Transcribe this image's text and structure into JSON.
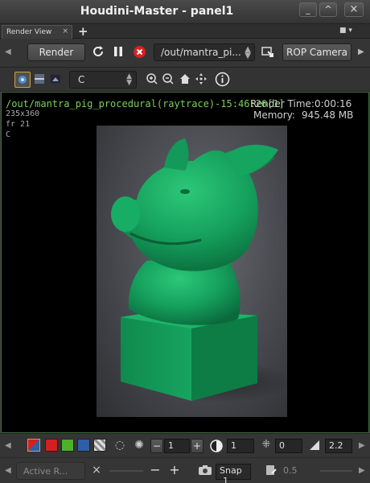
{
  "window": {
    "title": "Houdini-Master - panel1",
    "controls": [
      "_",
      "^",
      "×"
    ]
  },
  "tabs": {
    "active_label": "Render View",
    "close_glyph": "×",
    "add_glyph": "+",
    "menu_glyph": "■ ▾"
  },
  "toolbar1": {
    "render_label": "Render",
    "rop_path": "/out/mantra_pi...",
    "camera_label": "ROP Camera",
    "icons": [
      "refresh-icon",
      "pause-icon",
      "stop-icon",
      "render-region-icon"
    ]
  },
  "toolbar2": {
    "channel_value": "C",
    "icons": [
      "snapshot-icon",
      "compare-icon",
      "display-icon",
      "zoom-in-icon",
      "zoom-out-icon",
      "home-icon",
      "pan-icon",
      "info-icon"
    ]
  },
  "viewport": {
    "render_name": "/out/mantra_pig_procedural(raytrace)-15:46:26[1]",
    "resolution": "235x360",
    "frame": "fr 21",
    "channel": "C",
    "render_time_label": "Render Time:",
    "render_time_value": "0:00:16",
    "memory_label": "Memory:",
    "memory_value": "945.48 MB"
  },
  "toolbar3": {
    "swatches": [
      {
        "name": "rgb",
        "color": "#3a8f3a"
      },
      {
        "name": "red",
        "color": "#d42020"
      },
      {
        "name": "green",
        "color": "#4fb02a"
      },
      {
        "name": "blue",
        "color": "#2e5fa8"
      },
      {
        "name": "alpha",
        "color": "#bbbbbb"
      }
    ],
    "spinner_minus": "−",
    "spinner_plus": "+",
    "spinner_value": "1",
    "exposure_value": "1",
    "offset_value": "0",
    "gamma_value": "2.2"
  },
  "toolbar4": {
    "active_label": "Active R...",
    "clear_glyph": "×",
    "minus": "−",
    "plus": "+",
    "snap_label": "Snap",
    "snap_value": "1",
    "opacity_value": "0.5"
  },
  "colors": {
    "accent_green": "#7ad05a",
    "statue_green": "#17a05a"
  }
}
